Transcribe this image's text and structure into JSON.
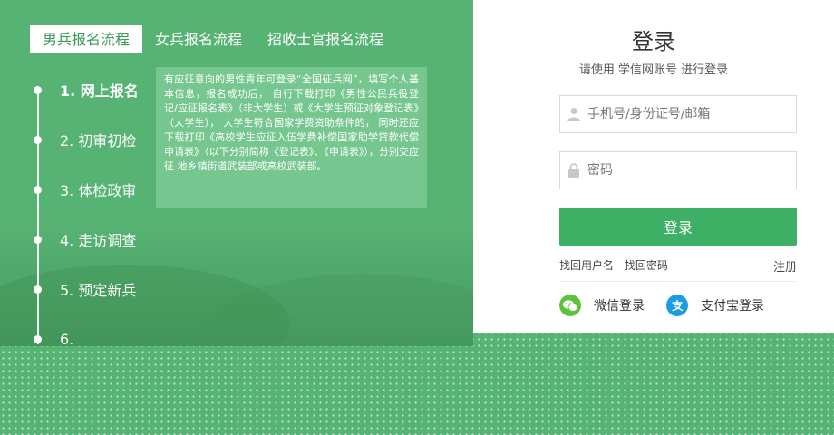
{
  "tabs": [
    {
      "label": "男兵报名流程"
    },
    {
      "label": "女兵报名流程"
    },
    {
      "label": "招收士官报名流程"
    }
  ],
  "steps": [
    {
      "label": "1. 网上报名"
    },
    {
      "label": "2. 初审初检"
    },
    {
      "label": "3. 体检政审"
    },
    {
      "label": "4. 走访调查"
    },
    {
      "label": "5. 预定新兵"
    },
    {
      "label": "6."
    }
  ],
  "tip": {
    "text": "有应征意向的男性青年可登录“全国征兵网”，填写个人基本信息，报名成功后， 自行下载打印《男性公民兵役登记/应征报名表》（非大学生）或《大学生预征对象登记表》（大学生）， 大学生符合国家学费资助条件的， 同时还应下载打印《高校学生应征入伍学费补偿国家助学贷款代偿申请表》（以下分别简称《登记表》、《申请表》），分别交应征 地乡镇街道武装部或高校武装部。"
  },
  "login": {
    "title": "登录",
    "subtitle": "请使用  学信网账号  进行登录",
    "username_placeholder": "手机号/身份证号/邮箱",
    "password_placeholder": "密码",
    "submit_label": "登录",
    "forgot_username": "找回用户名",
    "forgot_password": "找回密码",
    "register": "注册",
    "wechat_label": "微信登录",
    "alipay_label": "支付宝登录"
  },
  "icons": {
    "user": "user-icon",
    "lock": "lock-icon",
    "wechat": "wechat-icon",
    "alipay": "alipay-icon"
  },
  "colors": {
    "brand_green": "#3eb066",
    "hero_green": "#57b374",
    "wechat_green": "#5cc43c",
    "alipay_blue": "#1b9de0"
  }
}
